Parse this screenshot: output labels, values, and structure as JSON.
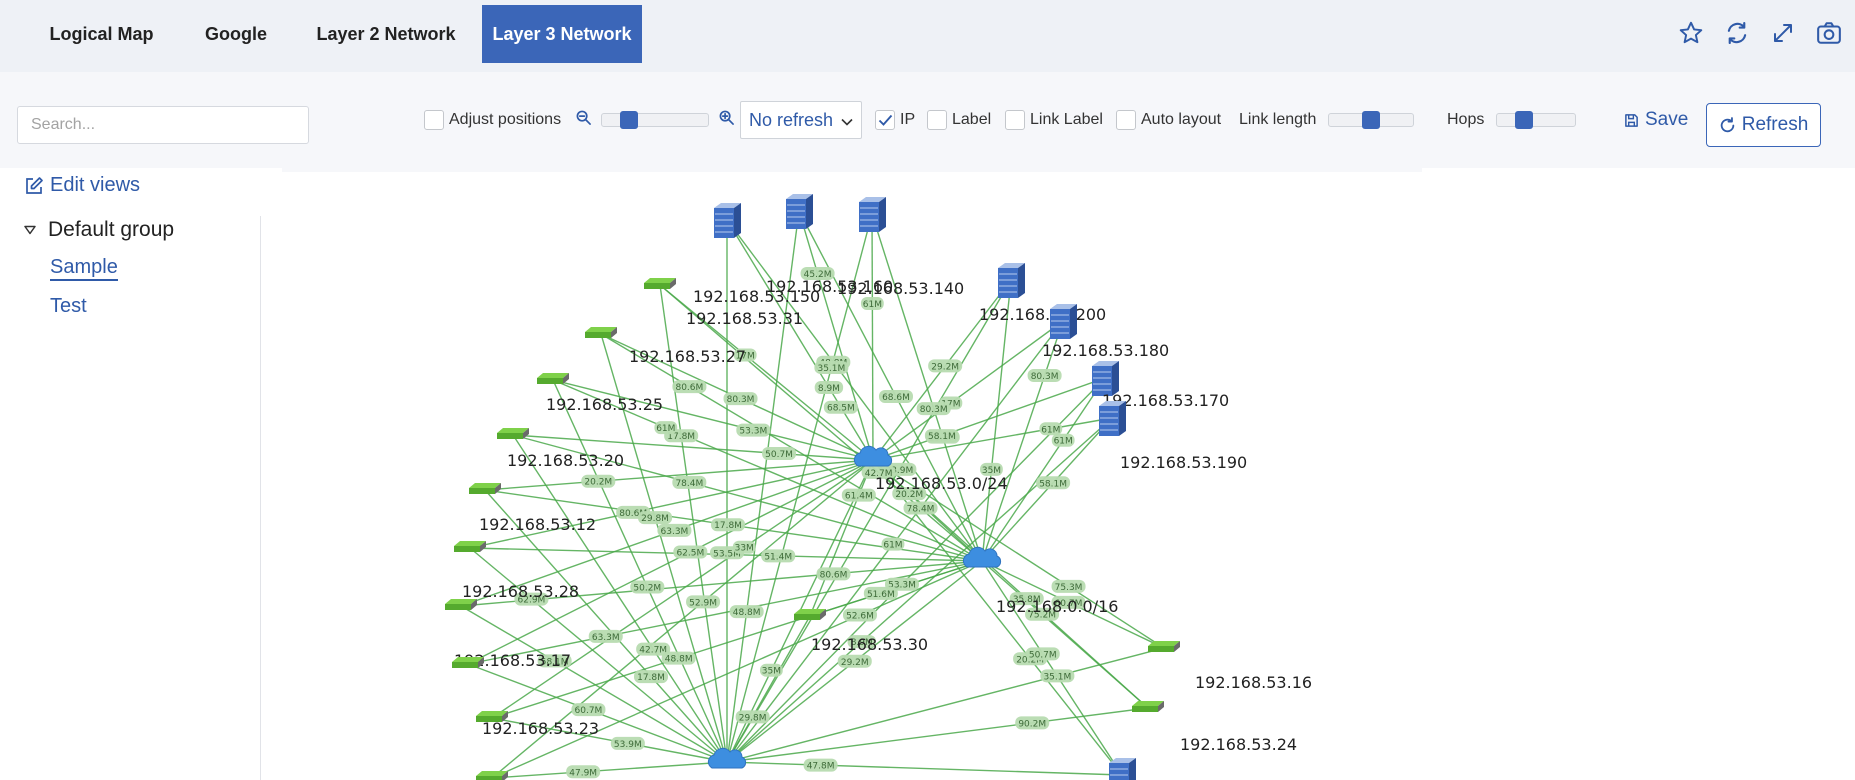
{
  "tabs": [
    {
      "label": "Logical Map",
      "active": false
    },
    {
      "label": "Google",
      "active": false
    },
    {
      "label": "Layer 2 Network",
      "active": false
    },
    {
      "label": "Layer 3 Network",
      "active": true
    }
  ],
  "top_icons": [
    "star-icon",
    "sync-icon",
    "expand-icon",
    "camera-icon"
  ],
  "toolbar": {
    "search_placeholder": "Search...",
    "adjust_positions": {
      "label": "Adjust positions",
      "checked": false
    },
    "zoom_level": 0.2,
    "refresh_select": "No refresh",
    "ip": {
      "label": "IP",
      "checked": true
    },
    "label": {
      "label": "Label",
      "checked": false
    },
    "link_label": {
      "label": "Link Label",
      "checked": false
    },
    "auto_layout": {
      "label": "Auto layout",
      "checked": false
    },
    "link_length": {
      "label": "Link length",
      "value": 0.5
    },
    "hops": {
      "label": "Hops",
      "value": 0.3
    },
    "save_label": "Save",
    "refresh_label": "Refresh"
  },
  "sidebar": {
    "edit_views": "Edit views",
    "group": "Default group",
    "views": [
      {
        "label": "Sample",
        "active": true
      },
      {
        "label": "Test",
        "active": false
      }
    ]
  },
  "colors": {
    "accent": "#3b66b8",
    "link": "#2f5aa8",
    "edge": "#4aa84a",
    "edge_label_bg": "#b7dbb0"
  },
  "network": {
    "clouds": [
      {
        "id": "c1",
        "label": "192.168.53.0/24"
      },
      {
        "id": "c2",
        "label": "192.168.0.0/16"
      },
      {
        "id": "c3",
        "label": ""
      }
    ],
    "servers": [
      {
        "id": "s1",
        "label": "192.168.53.150"
      },
      {
        "id": "s2",
        "label": "192.168.53.160"
      },
      {
        "id": "s3",
        "label": "192.168.53.140"
      },
      {
        "id": "s4",
        "label": "192.168.53.200"
      },
      {
        "id": "s5",
        "label": "192.168.53.180"
      },
      {
        "id": "s6",
        "label": "192.168.53.170"
      },
      {
        "id": "s7",
        "label": "192.168.53.190"
      },
      {
        "id": "s8",
        "label": ""
      }
    ],
    "switches": [
      {
        "id": "w1",
        "label": "192.168.53.31"
      },
      {
        "id": "w2",
        "label": "192.168.53.27"
      },
      {
        "id": "w3",
        "label": "192.168.53.25"
      },
      {
        "id": "w4",
        "label": "192.168.53.20"
      },
      {
        "id": "w5",
        "label": "192.168.53.12"
      },
      {
        "id": "w6",
        "label": "192.168.53.28"
      },
      {
        "id": "w7",
        "label": "192.168.53.17"
      },
      {
        "id": "w8",
        "label": "192.168.53.23"
      },
      {
        "id": "w9",
        "label": ""
      },
      {
        "id": "w10",
        "label": "192.168.53.30"
      },
      {
        "id": "w11",
        "label": "192.168.53.16"
      },
      {
        "id": "w12",
        "label": "192.168.53.24"
      },
      {
        "id": "w13",
        "label": ""
      }
    ],
    "link_labels": [
      "68.5M",
      "23.5M",
      "61M",
      "20.2M",
      "80.6M",
      "42.7M",
      "63.3M",
      "48.8M",
      "35.1M",
      "20.2M",
      "68.6M",
      "23.9M",
      "61M",
      "42.7M",
      "50.2M",
      "80.6M",
      "63.3M",
      "29.8M",
      "52.9M",
      "48.8M",
      "35.1M",
      "58.1M",
      "50.7M",
      "29.8M",
      "20.2M",
      "80.6M",
      "53.9M",
      "35.8M",
      "35M",
      "48.8M",
      "17M",
      "58.1M",
      "17.8M",
      "50.7M",
      "51.4M",
      "60.7M",
      "75.3M",
      "52.6M",
      "53.5M",
      "29.2M",
      "61M",
      "47.8M",
      "53.3M",
      "17.8M",
      "58.1M",
      "61.4M",
      "75.2M",
      "29.2M",
      "61M",
      "80.3M",
      "8.9M",
      "80.3M",
      "78.4M",
      "62.9M",
      "33M",
      "60.7M",
      "47.9M",
      "45.2M",
      "35M",
      "53.3M",
      "17M",
      "61M",
      "17.8M",
      "62.5M",
      "51.6M",
      "90.2M",
      "8.9M",
      "80.3M",
      "78.4M"
    ]
  }
}
